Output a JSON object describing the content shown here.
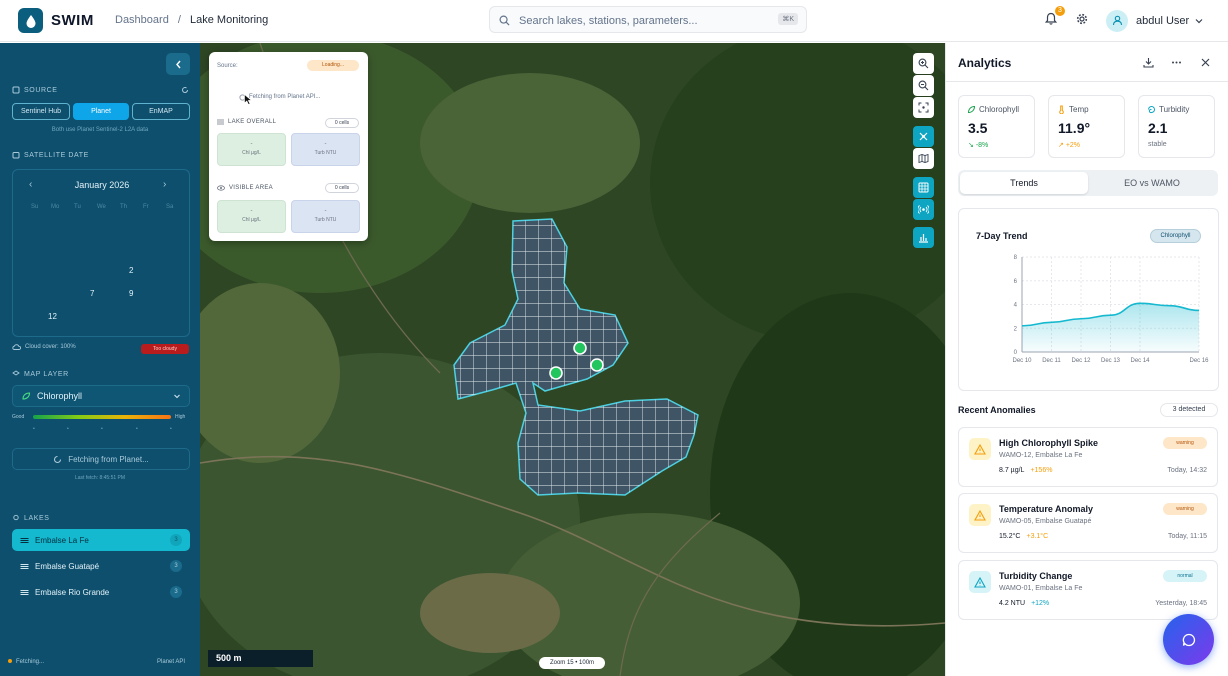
{
  "app": {
    "brand": "SWIM"
  },
  "breadcrumb": {
    "root": "Dashboard",
    "sep": "/",
    "current": "Lake Monitoring"
  },
  "search": {
    "placeholder": "Search lakes, stations, parameters...",
    "shortcut": "⌘K"
  },
  "header": {
    "notifications": "3",
    "user_name": "abdul User"
  },
  "sidebar": {
    "source_label": "SOURCE",
    "sources": [
      "Sentinel Hub",
      "Planet",
      "EnMAP"
    ],
    "source_selected": "Planet",
    "source_note": "Both use Planet Sentinel-2 L2A data",
    "date_label": "SATELLITE DATE",
    "month": "January 2026",
    "weekdays": [
      "Su",
      "Mo",
      "Tu",
      "We",
      "Th",
      "Fr",
      "Sa"
    ],
    "highlighted_days": [
      "2",
      "7",
      "9",
      "12"
    ],
    "cloud_cover": "Cloud cover: 100%",
    "cloud_badge": "Too cloudy",
    "map_layer_label": "MAP LAYER",
    "map_layer": "Chlorophyll",
    "legend_low": "Good",
    "legend_high": "High",
    "fetch_button": "Fetching from Planet...",
    "last_fetch": "Last fetch: 8:45:51 PM",
    "lakes_label": "LAKES",
    "lakes": [
      {
        "name": "Embalse La Fe",
        "count": "3"
      },
      {
        "name": "Embalse Guatapé",
        "count": "3"
      },
      {
        "name": "Embalse Rio Grande",
        "count": "3"
      }
    ],
    "footer_status": "Fetching...",
    "footer_api": "Planet API"
  },
  "map_popup": {
    "source_label": "Source:",
    "loading": "Loading...",
    "fetching": "Fetching from Planet API...",
    "lake_overall": "LAKE OVERALL",
    "lake_overall_cells": "0 cells",
    "visible_area": "VISIBLE AREA",
    "visible_area_cells": "0 cells",
    "chl_value": "-",
    "chl_unit": "Chl µg/L",
    "turb_value": "-",
    "turb_unit": "Turb NTU"
  },
  "map": {
    "scale": "500 m",
    "zoom": "Zoom 15 • 100m"
  },
  "analytics": {
    "title": "Analytics",
    "kpis": [
      {
        "label": "Chlorophyll",
        "value": "3.5",
        "change": "-8%",
        "change_color": "#16a34a"
      },
      {
        "label": "Temp",
        "value": "11.9°",
        "change": "+2%",
        "change_color": "#f59e0b"
      },
      {
        "label": "Turbidity",
        "value": "2.1",
        "change": "stable",
        "change_color": "#6b7280"
      }
    ],
    "tabs": [
      "Trends",
      "EO vs WAMO"
    ],
    "trend_title": "7-Day Trend",
    "trend_pill": "Chlorophyll",
    "anomalies_title": "Recent Anomalies",
    "anomalies_count": "3 detected",
    "anomalies": [
      {
        "title": "High Chlorophyll Spike",
        "station": "WAMO-12, Embalse La Fe",
        "value": "8.7 µg/L",
        "delta": "+156%",
        "delta_color": "#f59e0b",
        "time": "Today, 14:32",
        "severity": "warning"
      },
      {
        "title": "Temperature Anomaly",
        "station": "WAMO-05, Embalse Guatapé",
        "value": "15.2°C",
        "delta": "+3.1°C",
        "delta_color": "#f59e0b",
        "time": "Today, 11:15",
        "severity": "warning"
      },
      {
        "title": "Turbidity Change",
        "station": "WAMO-01, Embalse La Fe",
        "value": "4.2 NTU",
        "delta": "+12%",
        "delta_color": "#0ea5c2",
        "time": "Yesterday, 18:45",
        "severity": "normal"
      }
    ]
  },
  "chart_data": {
    "type": "area",
    "title": "7-Day Trend",
    "series": [
      {
        "name": "Chlorophyll",
        "x": [
          "Dec 10",
          "Dec 11",
          "Dec 12",
          "Dec 13",
          "Dec 14",
          "Dec 15",
          "Dec 16"
        ],
        "values": [
          2.2,
          2.5,
          2.8,
          3.1,
          4.1,
          3.9,
          3.5
        ]
      }
    ],
    "x_ticks": [
      "Dec 10",
      "Dec 11",
      "Dec 12",
      "Dec 13",
      "Dec 14",
      "Dec 16"
    ],
    "ylim": [
      0,
      8
    ],
    "y_ticks": [
      0,
      2,
      4,
      6,
      8
    ],
    "grid": true,
    "color": "#14b8cf"
  }
}
